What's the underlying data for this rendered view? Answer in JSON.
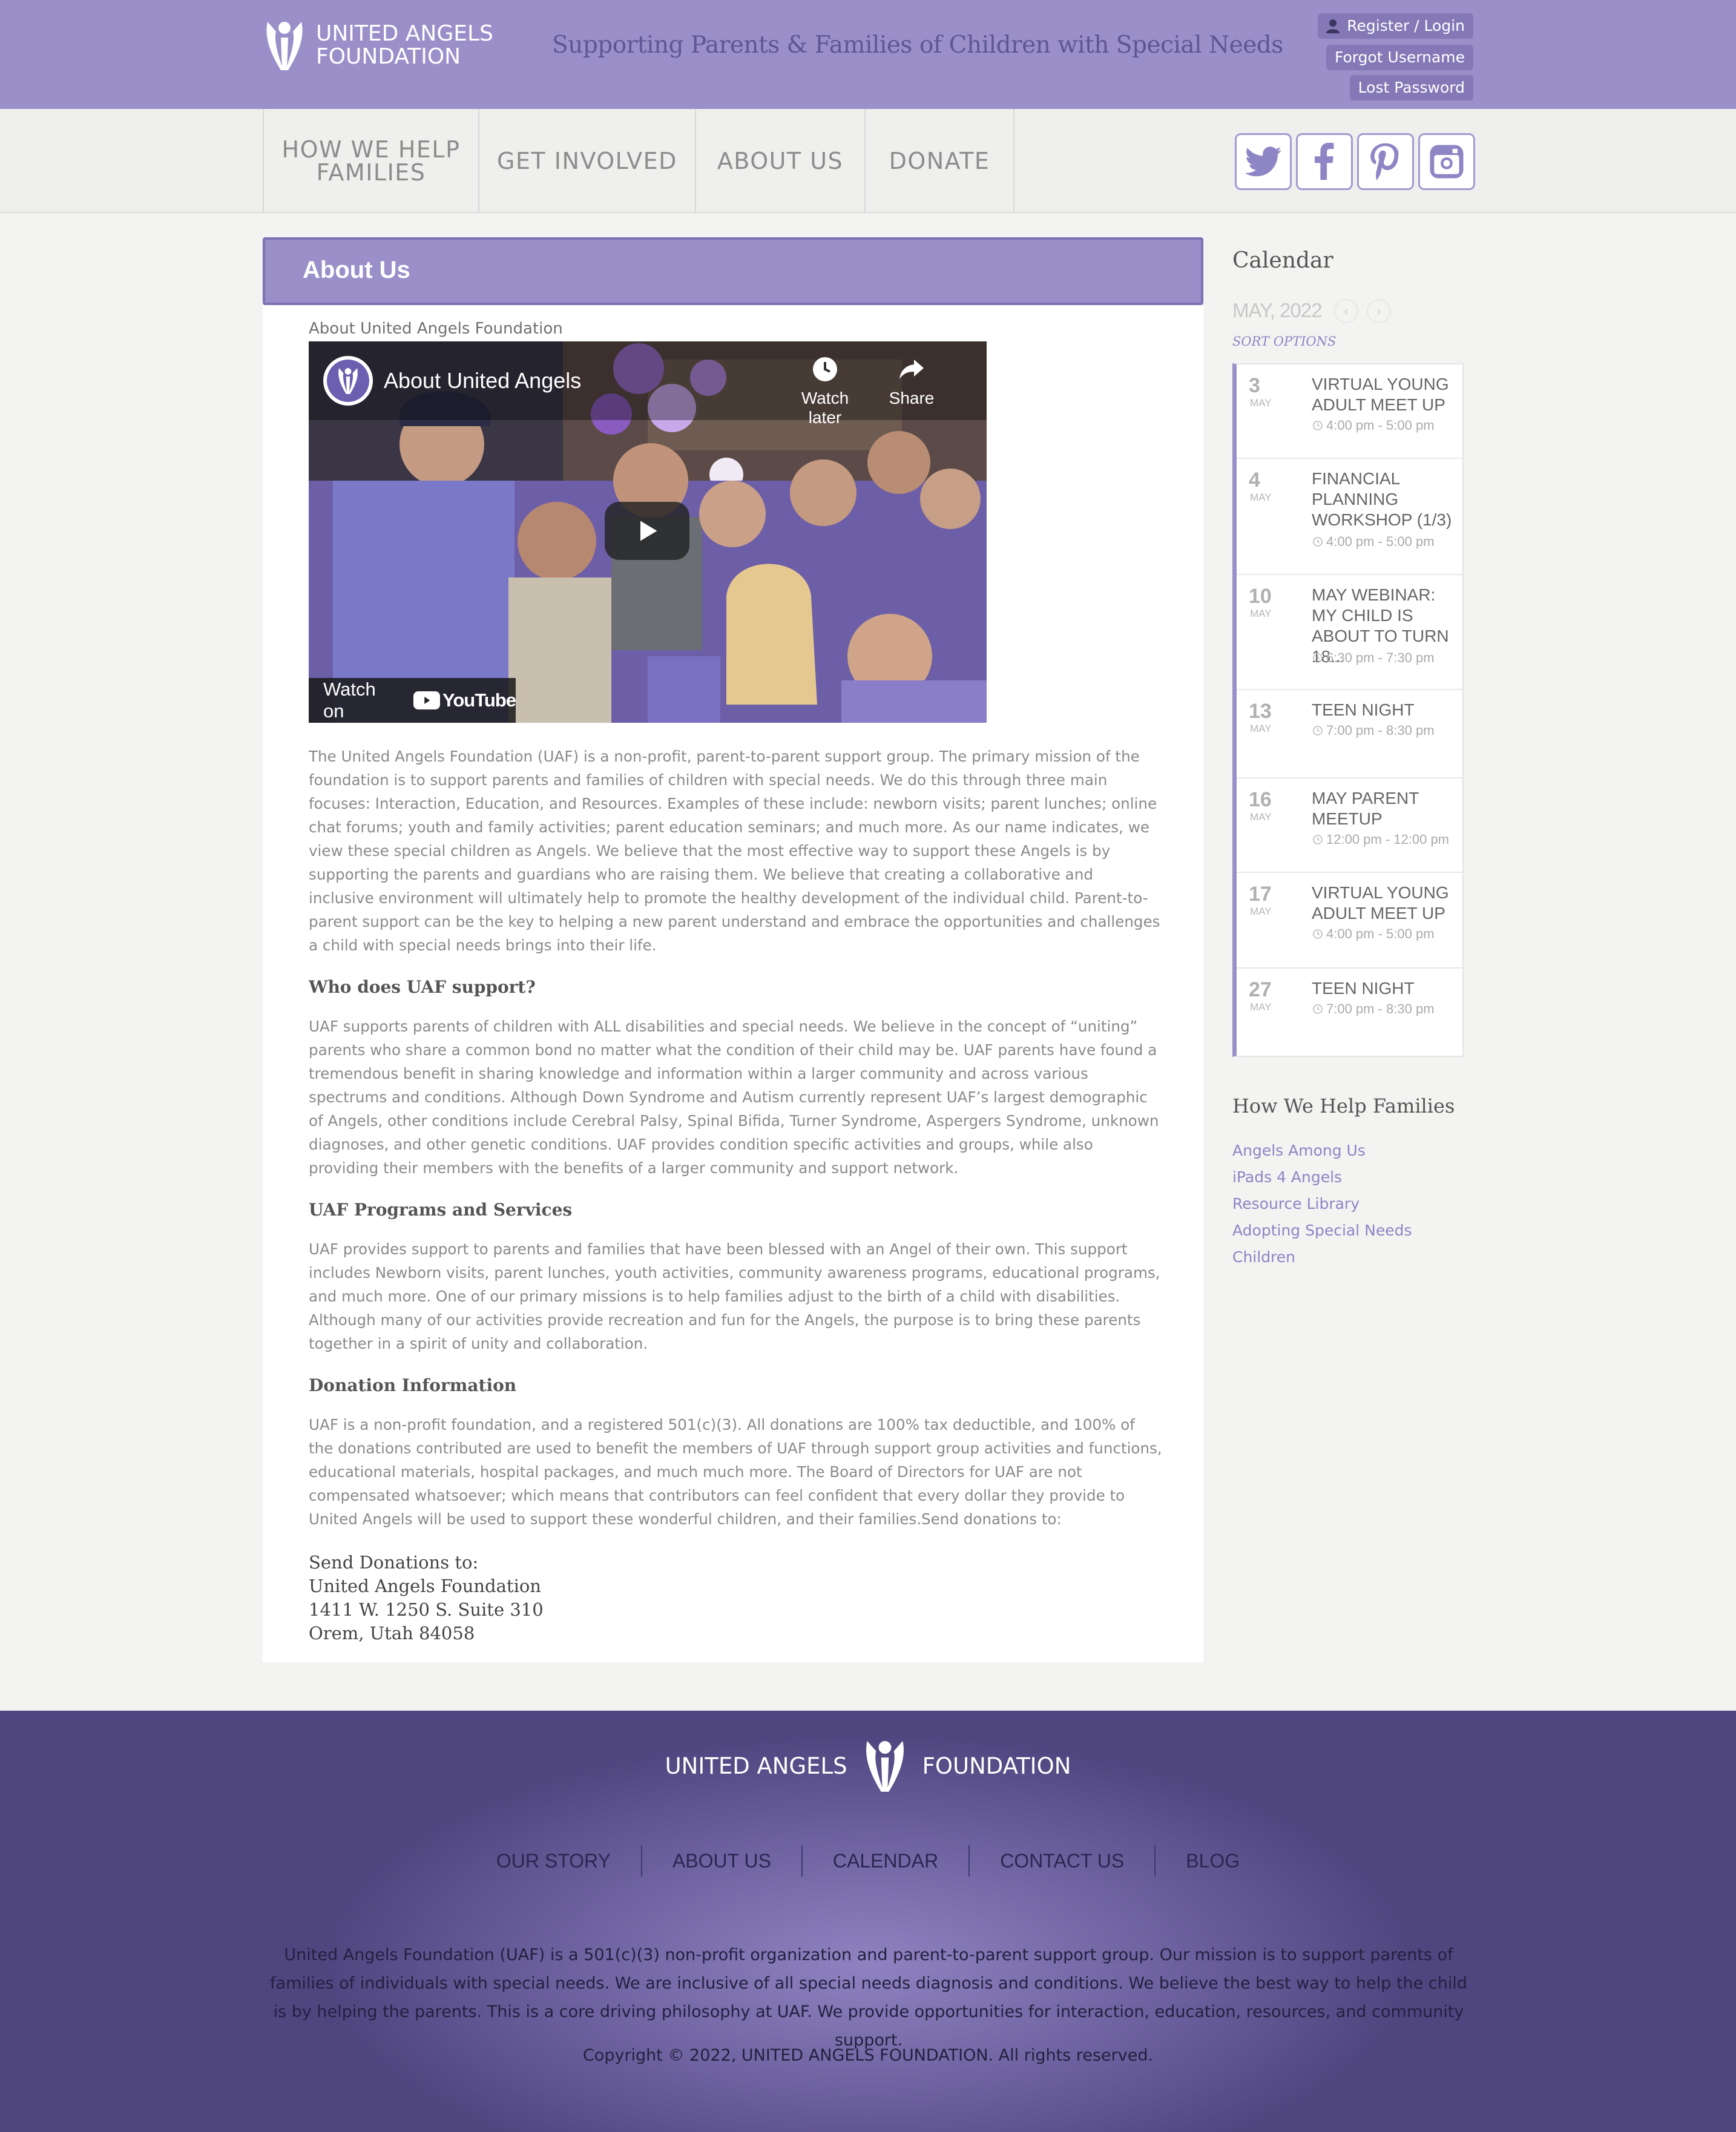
{
  "header": {
    "logo_line1": "UNITED ANGELS",
    "logo_line2": "FOUNDATION",
    "tagline": "Supporting Parents & Families of  Children with Special Needs",
    "register_login": "Register / Login",
    "forgot_username": "Forgot Username",
    "lost_password": "Lost Password"
  },
  "nav": {
    "items": [
      {
        "label_line1": "HOW WE HELP",
        "label_line2": "FAMILIES"
      },
      {
        "label": "GET INVOLVED"
      },
      {
        "label": "ABOUT US"
      },
      {
        "label": "DONATE"
      }
    ],
    "social": [
      "twitter-icon",
      "facebook-icon",
      "pinterest-icon",
      "instagram-icon"
    ]
  },
  "main": {
    "page_title": "About Us",
    "video_caption": "About United Angels Foundation",
    "video": {
      "title": "About United Angels",
      "watch_later": "Watch later",
      "share": "Share",
      "watch_on": "Watch on",
      "youtube": "YouTube"
    },
    "intro": "The United Angels Foundation (UAF) is a non-profit, parent-to-parent support group. The primary mission of the foundation is to support parents and families of children with special needs. We do this through three main focuses: Interaction, Education, and Resources. Examples of these include: newborn visits; parent lunches; online chat forums; youth and family activities; parent education seminars; and much more. As our name indicates, we view these special children as Angels. We believe that the most effective way to support these Angels is by supporting the parents and guardians who are raising them. We believe that creating a collaborative and inclusive environment will ultimately help to promote the healthy development of the individual child. Parent-to-parent support can be the key to helping a new parent understand and embrace the opportunities and challenges a child with special needs brings into their life.",
    "who_heading": "Who does UAF support?",
    "who_text": "UAF supports parents of children with ALL disabilities and special needs. We believe in the concept of “uniting” parents who share a common bond no matter what the condition of their child may be. UAF parents have found a tremendous benefit in sharing knowledge and information within a larger community and across various spectrums and conditions. Although Down Syndrome and Autism currently represent UAF’s largest demographic of Angels, other conditions include Cerebral Palsy, Spinal Bifida, Turner Syndrome, Aspergers Syndrome, unknown diagnoses, and other genetic conditions. UAF provides condition specific activities and groups, while also providing their members with the benefits of a larger community and support network.",
    "programs_heading": "UAF Programs and Services",
    "programs_text": "UAF provides support to parents and families that have been blessed with an Angel of their own. This support includes Newborn visits, parent lunches, youth activities, community awareness programs, educational programs, and much more. One of our primary missions is to help families adjust to the birth of a child with disabilities. Although many of our activities provide recreation and fun for the Angels, the purpose is to bring these parents together in a spirit of unity and collaboration.",
    "donation_heading": "Donation Information",
    "donation_text": "UAF is a non-profit foundation, and a registered 501(c)(3). All donations are 100% tax deductible, and 100% of the donations contributed are used to benefit the members of UAF through support group activities and functions, educational materials, hospital packages, and much much more. The Board of Directors for UAF are not compensated whatsoever; which means that contributors can feel confident that every dollar they provide to United Angels will be used to support these wonderful children, and their families.Send donations to:",
    "address": [
      "Send Donations to:",
      "United Angels Foundation",
      "1411 W. 1250 S. Suite 310",
      "Orem, Utah 84058"
    ]
  },
  "sidebar": {
    "calendar_title": "Calendar",
    "month": "MAY, 2022",
    "sort_options": "SORT OPTIONS",
    "events": [
      {
        "day": "3",
        "month": "MAY",
        "title": "VIRTUAL YOUNG ADULT MEET UP",
        "time": "4:00 pm - 5:00 pm"
      },
      {
        "day": "4",
        "month": "MAY",
        "title": "FINANCIAL PLANNING WORKSHOP (1/3)",
        "time": "4:00 pm - 5:00 pm"
      },
      {
        "day": "10",
        "month": "MAY",
        "title": "MAY WEBINAR: MY CHILD IS ABOUT TO TURN 18...",
        "time": "6:30 pm - 7:30 pm"
      },
      {
        "day": "13",
        "month": "MAY",
        "title": "TEEN NIGHT",
        "time": "7:00 pm - 8:30 pm"
      },
      {
        "day": "16",
        "month": "MAY",
        "title": "MAY PARENT MEETUP",
        "time": "12:00 pm - 12:00 pm"
      },
      {
        "day": "17",
        "month": "MAY",
        "title": "VIRTUAL YOUNG ADULT MEET UP",
        "time": "4:00 pm - 5:00 pm"
      },
      {
        "day": "27",
        "month": "MAY",
        "title": "TEEN NIGHT",
        "time": "7:00 pm - 8:30 pm"
      }
    ],
    "help_title": "How We Help Families",
    "help_links": [
      "Angels Among Us",
      "iPads 4 Angels",
      "Resource Library",
      "Adopting Special Needs",
      "Children"
    ]
  },
  "footer": {
    "logo_left": "UNITED ANGELS",
    "logo_right": "FOUNDATION",
    "nav": [
      "OUR STORY",
      "ABOUT US",
      "CALENDAR",
      "CONTACT US",
      "BLOG"
    ],
    "description": "United Angels Foundation (UAF) is a 501(c)(3) non-profit organization and parent-to-parent support group. Our mission is to support parents of families of individuals with special needs. We are inclusive of all special needs diagnosis and conditions. We believe the best way to help the child is by helping the parents. This is a core driving philosophy at UAF. We provide opportunities for interaction, education, resources, and community support.",
    "copyright": "Copyright © 2022, UNITED ANGELS FOUNDATION. All rights reserved."
  },
  "colors": {
    "brand_purple": "#9b8fca",
    "dark_purple": "#4f4680",
    "link": "#8d85c4"
  }
}
